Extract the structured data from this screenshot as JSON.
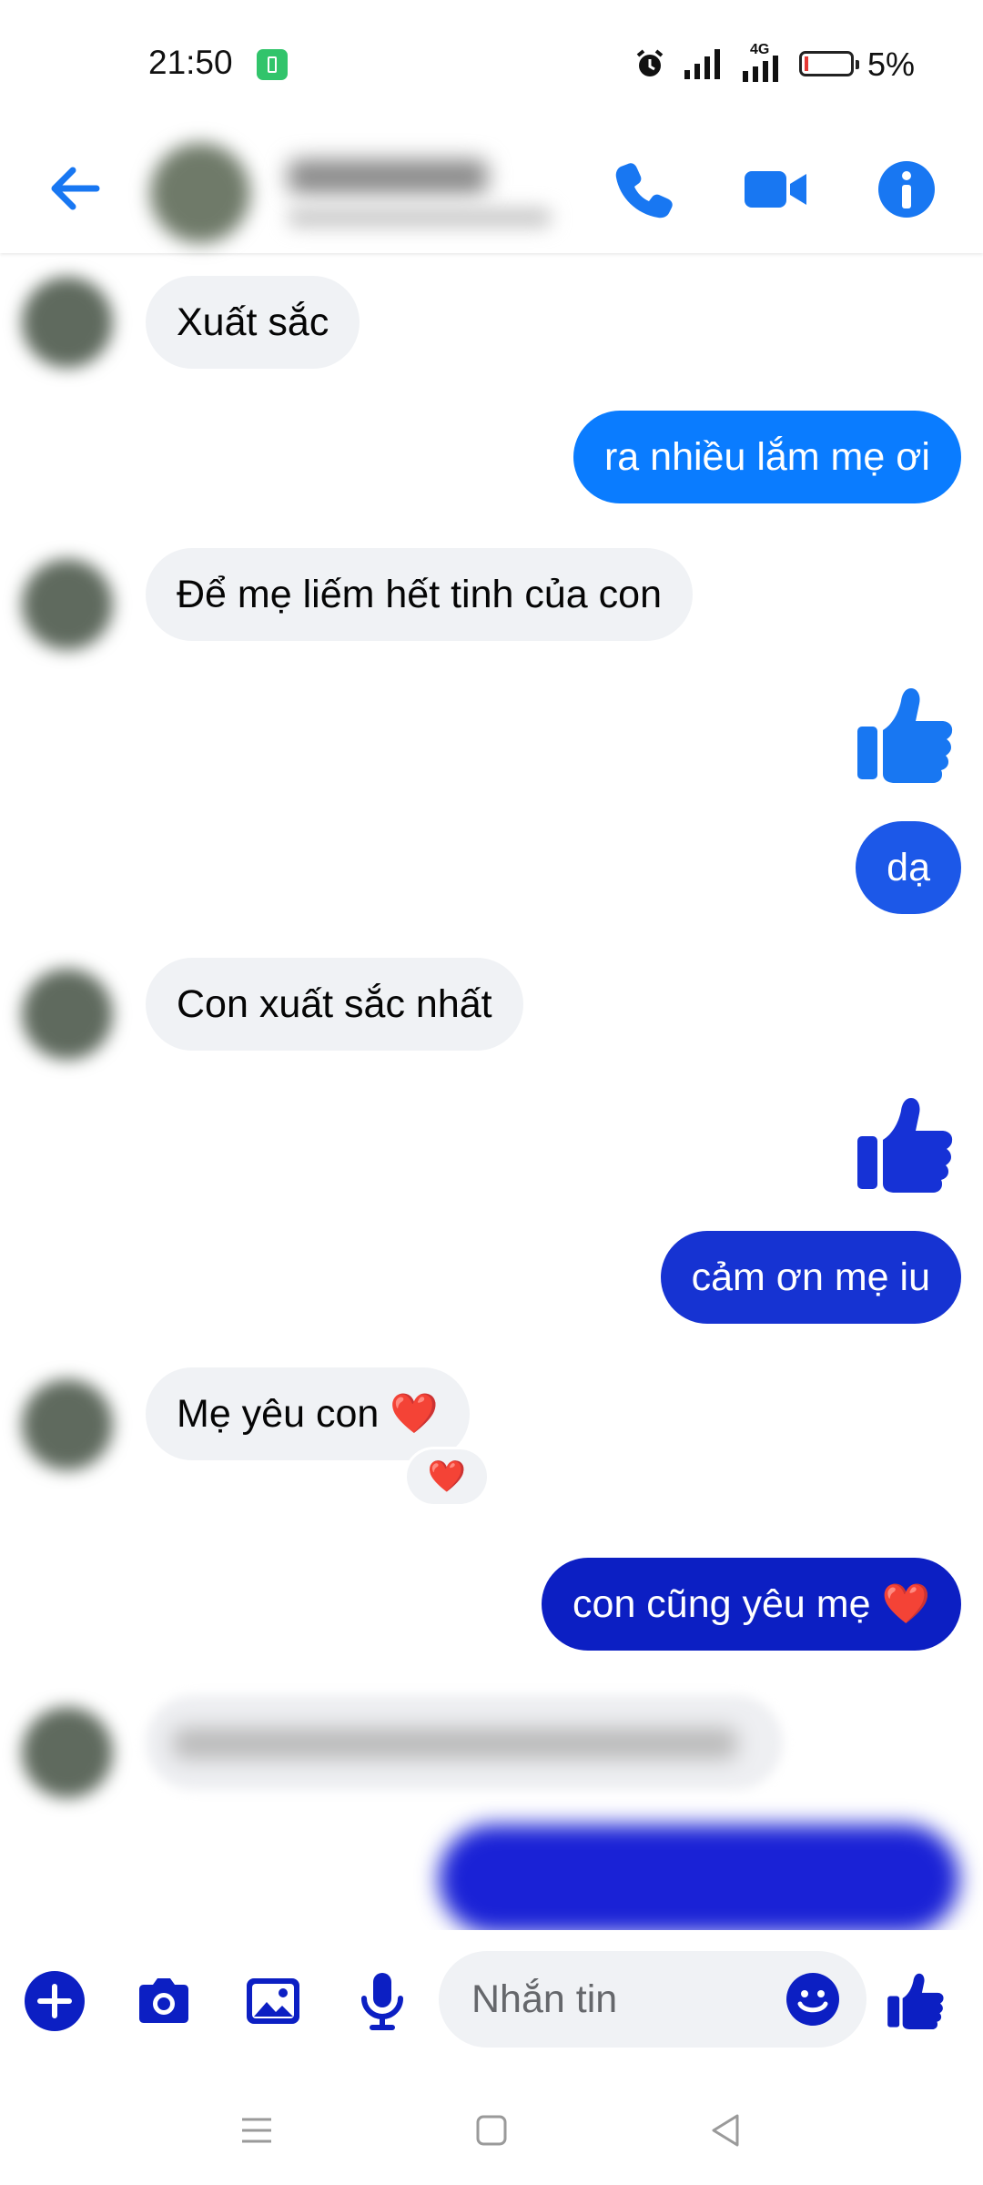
{
  "status_bar": {
    "time": "21:50",
    "battery_percent": "5%",
    "network_label": "4G"
  },
  "header": {
    "contact_name": "",
    "icons": [
      "back-arrow-icon",
      "phone-icon",
      "video-camera-icon",
      "info-icon"
    ]
  },
  "colors": {
    "accent": "#1877f2",
    "bubble_incoming": "#f0f2f5",
    "bubble_out_gradient": [
      "#0a7cff",
      "#1c58e8",
      "#1632d6",
      "#0c1fc3"
    ],
    "heart": "#e41e3f"
  },
  "messages": [
    {
      "side": "in",
      "text": "Xuất sắc"
    },
    {
      "side": "out",
      "text": "ra nhiều lắm mẹ ơi"
    },
    {
      "side": "in",
      "text": "Để mẹ liếm hết tinh của con"
    },
    {
      "side": "out",
      "type": "like"
    },
    {
      "side": "out",
      "text": "dạ"
    },
    {
      "side": "in",
      "text": "Con xuất sắc nhất"
    },
    {
      "side": "out",
      "type": "like"
    },
    {
      "side": "out",
      "text": "cảm ơn mẹ iu"
    },
    {
      "side": "in",
      "text": "Mẹ yêu con ❤️",
      "reaction": "❤️"
    },
    {
      "side": "out",
      "text": "con cũng yêu mẹ ❤️"
    }
  ],
  "composer": {
    "placeholder": "Nhắn tin",
    "icons": [
      "plus-icon",
      "camera-icon",
      "gallery-icon",
      "microphone-icon",
      "emoji-icon",
      "like-icon"
    ]
  }
}
